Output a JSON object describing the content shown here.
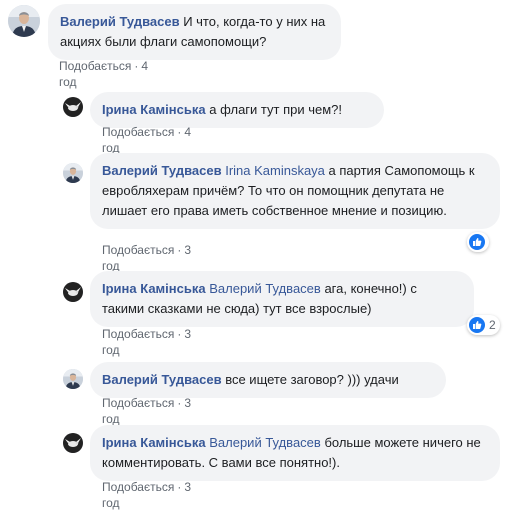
{
  "colors": {
    "author": "#385898",
    "bubble": "#f2f3f5",
    "like_blue": "#1877f2",
    "meta": "#606770"
  },
  "comments": [
    {
      "author": "Валерий Тудвасев",
      "mention": "",
      "text": "И что, когда-то у них на акциях были флаги самопомощи?",
      "like_label": "Подобається",
      "time": "4 год"
    },
    {
      "author": "Ірина Камінська",
      "mention": "",
      "text": "а флаги тут при чем?!",
      "like_label": "Подобається",
      "time": "4 год"
    },
    {
      "author": "Валерий Тудвасев",
      "mention": "Irina Kaminskaya",
      "text": "а партия Самопомощь к евробляхерам причём? То что он помощник депутата не лишает его права иметь собственное мнение и позицию.",
      "like_label": "Подобається",
      "time": "3 год",
      "reaction": {
        "icon": "thumbs-up-icon",
        "count": ""
      }
    },
    {
      "author": "Ірина Камінська",
      "mention": "Валерий Тудвасев",
      "text": "ага, конечно!) с такими сказками не сюда) тут все взрослые)",
      "like_label": "Подобається",
      "time": "3 год",
      "reaction": {
        "icon": "thumbs-up-icon",
        "count": "2"
      }
    },
    {
      "author": "Валерий Тудвасев",
      "mention": "",
      "text": "все ищете заговор? ))) удачи",
      "like_label": "Подобається",
      "time": "3 год"
    },
    {
      "author": "Ірина Камінська",
      "mention": "Валерий Тудвасев",
      "text": "больше можете ничего не комментировать. С вами все понятно!).",
      "like_label": "Подобається",
      "time": "3 год"
    }
  ]
}
